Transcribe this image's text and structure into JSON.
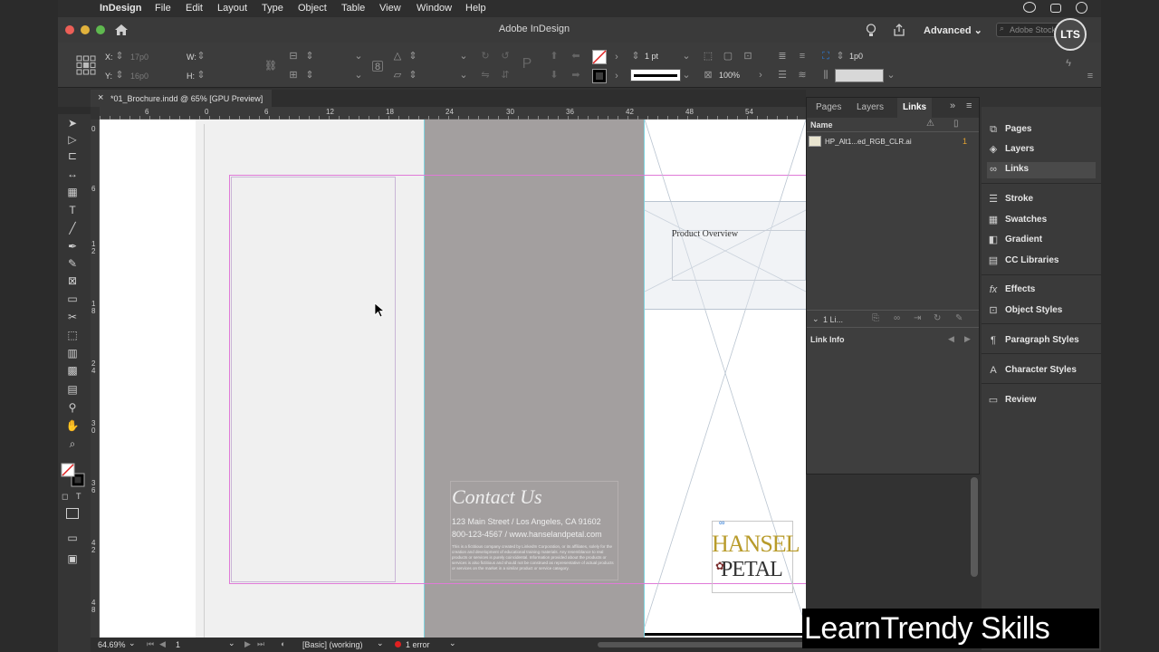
{
  "menubar": {
    "app": "InDesign",
    "items": [
      "File",
      "Edit",
      "Layout",
      "Type",
      "Object",
      "Table",
      "View",
      "Window",
      "Help"
    ]
  },
  "window": {
    "title": "Adobe InDesign",
    "workspace": "Advanced",
    "search_placeholder": "Adobe Stock"
  },
  "control": {
    "x_label": "X:",
    "x_value": "17p0",
    "y_label": "Y:",
    "y_value": "16p0",
    "w_label": "W:",
    "h_label": "H:",
    "stroke_weight": "1 pt",
    "opacity": "100%",
    "offset": "1p0"
  },
  "document_tab": {
    "close": "×",
    "label": "*01_Brochure.indd @ 65% [GPU Preview]"
  },
  "rulers": {
    "h_ticks": [
      "6",
      "0",
      "6",
      "12",
      "18",
      "24",
      "30",
      "36",
      "42",
      "48",
      "54"
    ],
    "v_ticks": [
      "0",
      "6",
      "1\n2",
      "1\n8",
      "2\n4",
      "3\n0",
      "3\n6",
      "4\n2",
      "4\n8"
    ]
  },
  "canvas": {
    "product_overview": "Product Overview",
    "contact_title": "Contact Us",
    "contact_address": "123 Main Street  /  Los Angeles, CA 91602",
    "contact_phone_web": "800-123-4567  /  www.hanselandpetal.com",
    "disclaimer": "This is a fictitious company created by LinkedIn Corporation, or its affiliates, solely for the creation and development of educational training materials. Any resemblance to real products or services is purely coincidental. Information provided about the products or services is also fictitious and should not be construed as representative of actual products or services on the market in a similar product or service category.",
    "logo_top": "HANSEL",
    "logo_bottom": "PETAL"
  },
  "status": {
    "zoom": "64.69%",
    "page": "1",
    "preflight_profile": "[Basic] (working)",
    "errors": "1 error"
  },
  "links_panel": {
    "tabs": [
      "Pages",
      "Layers",
      "Links"
    ],
    "active_tab": "Links",
    "column_name": "Name",
    "files": [
      {
        "name": "HP_Alt1...ed_RGB_CLR.ai",
        "page": "1"
      }
    ],
    "count_label": "1 Li...",
    "link_info": "Link Info"
  },
  "dock": {
    "items": [
      {
        "label": "Pages",
        "icon": "pages-icon"
      },
      {
        "label": "Layers",
        "icon": "layers-icon"
      },
      {
        "label": "Links",
        "icon": "links-icon"
      },
      {
        "label": "Stroke",
        "icon": "stroke-icon"
      },
      {
        "label": "Swatches",
        "icon": "swatches-icon"
      },
      {
        "label": "Gradient",
        "icon": "gradient-icon"
      },
      {
        "label": "CC Libraries",
        "icon": "cc-libraries-icon"
      },
      {
        "label": "Effects",
        "icon": "effects-icon"
      },
      {
        "label": "Object Styles",
        "icon": "object-styles-icon"
      },
      {
        "label": "Paragraph Styles",
        "icon": "paragraph-styles-icon"
      },
      {
        "label": "Character Styles",
        "icon": "character-styles-icon"
      },
      {
        "label": "Review",
        "icon": "review-icon"
      }
    ]
  },
  "watermark": "LearnTrendy Skills",
  "badge": "LTS",
  "colors": {
    "accent_blue": "#2d7bd8",
    "frame_magenta": "#e07ad8",
    "guide_cyan": "#7fd4e0",
    "gray_panel": "#a39f9f",
    "logo_gold": "#b89b2a"
  }
}
